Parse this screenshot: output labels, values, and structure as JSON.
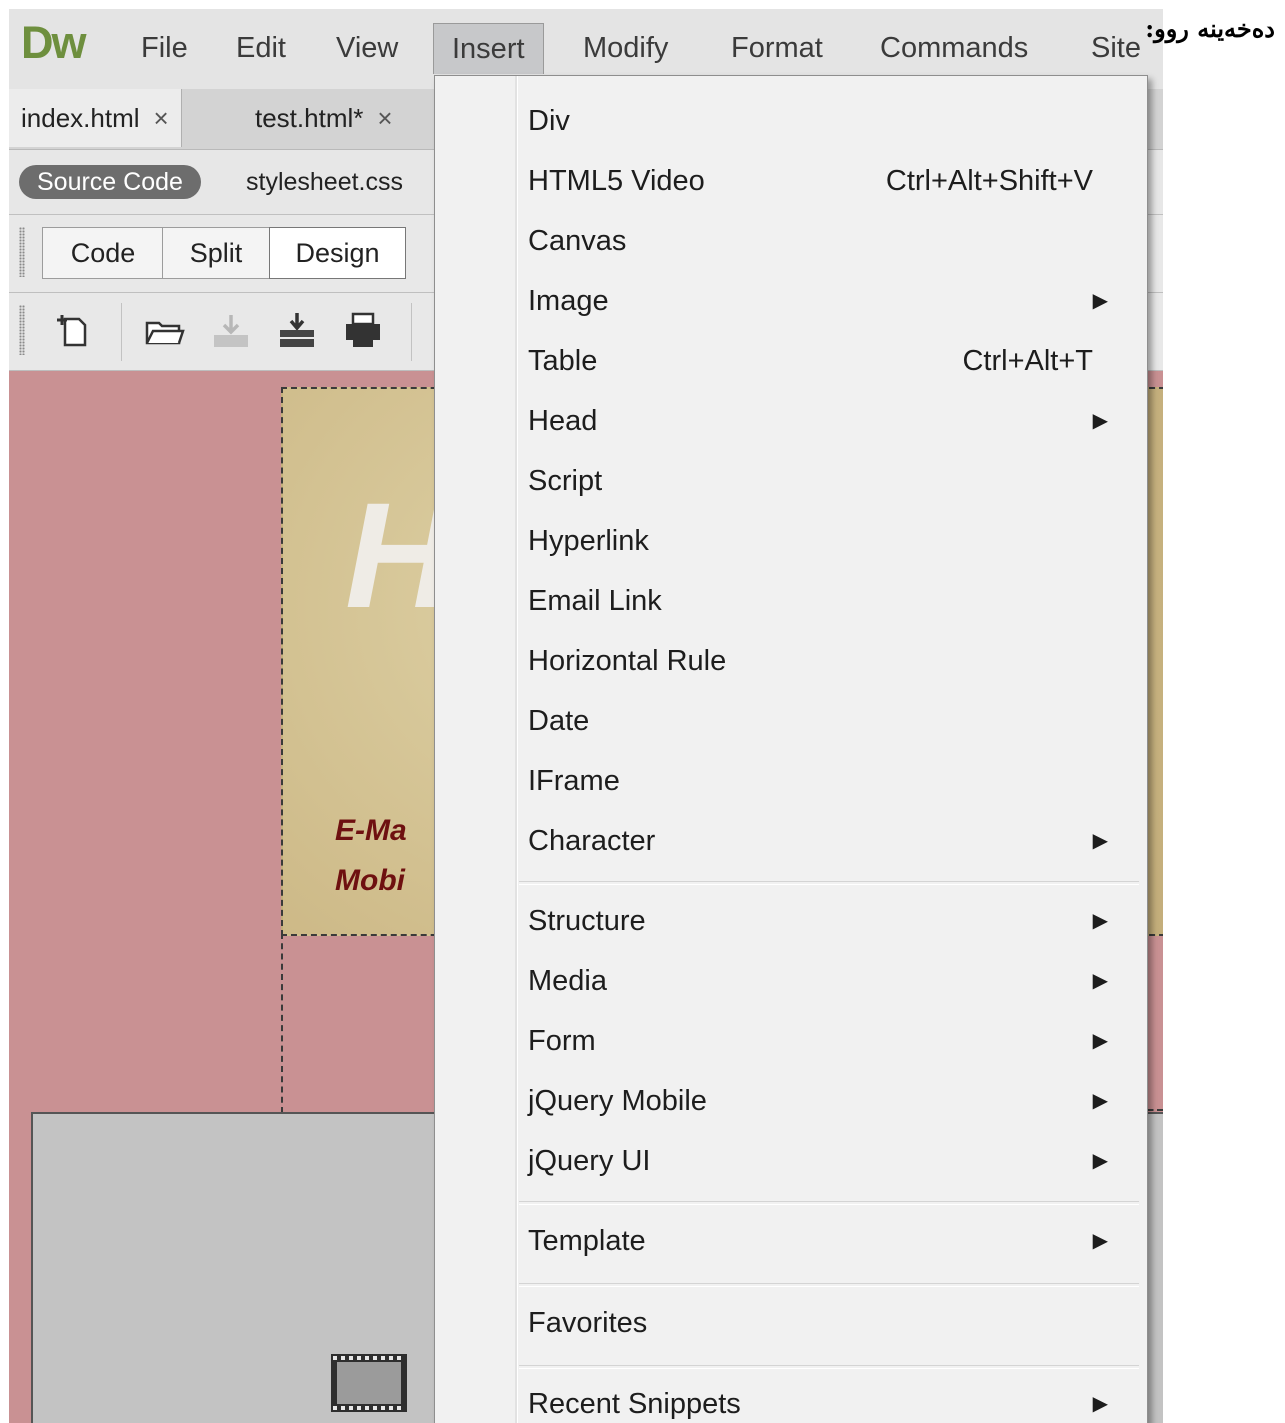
{
  "app": {
    "logo": "Dw"
  },
  "menubar": {
    "items": [
      "File",
      "Edit",
      "View",
      "Insert",
      "Modify",
      "Format",
      "Commands",
      "Site"
    ],
    "active": "Insert"
  },
  "tabs": [
    {
      "label": "index.html",
      "close": "×"
    },
    {
      "label": "test.html*",
      "close": "×"
    }
  ],
  "related_files": {
    "source_code": "Source Code",
    "file": "stylesheet.css"
  },
  "view_buttons": [
    "Code",
    "Split",
    "Design"
  ],
  "toolbar_icons": [
    "new-document-icon",
    "open-folder-icon",
    "save-down-icon",
    "save-all-icon",
    "print-icon"
  ],
  "canvas": {
    "header_initial": "H",
    "email_fragment": "E-Ma",
    "mobile_fragment": "Mobi"
  },
  "dropdown": {
    "items": [
      {
        "label": "Div",
        "shortcut": "",
        "submenu": false
      },
      {
        "label": "HTML5 Video",
        "shortcut": "Ctrl+Alt+Shift+V",
        "submenu": false
      },
      {
        "label": "Canvas",
        "shortcut": "",
        "submenu": false
      },
      {
        "label": "Image",
        "shortcut": "",
        "submenu": true
      },
      {
        "label": "Table",
        "shortcut": "Ctrl+Alt+T",
        "submenu": false
      },
      {
        "label": "Head",
        "shortcut": "",
        "submenu": true
      },
      {
        "label": "Script",
        "shortcut": "",
        "submenu": false
      },
      {
        "label": "Hyperlink",
        "shortcut": "",
        "submenu": false
      },
      {
        "label": "Email Link",
        "shortcut": "",
        "submenu": false
      },
      {
        "label": "Horizontal Rule",
        "shortcut": "",
        "submenu": false
      },
      {
        "label": "Date",
        "shortcut": "",
        "submenu": false
      },
      {
        "label": "IFrame",
        "shortcut": "",
        "submenu": false
      },
      {
        "label": "Character",
        "shortcut": "",
        "submenu": true
      },
      {
        "label": "Structure",
        "shortcut": "",
        "submenu": true
      },
      {
        "label": "Media",
        "shortcut": "",
        "submenu": true
      },
      {
        "label": "Form",
        "shortcut": "",
        "submenu": true
      },
      {
        "label": "jQuery Mobile",
        "shortcut": "",
        "submenu": true
      },
      {
        "label": "jQuery UI",
        "shortcut": "",
        "submenu": true
      },
      {
        "label": "Template",
        "shortcut": "",
        "submenu": true
      },
      {
        "label": "Favorites",
        "shortcut": "",
        "submenu": false
      },
      {
        "label": "Recent Snippets",
        "shortcut": "",
        "submenu": true
      }
    ],
    "submenu_arrow": "▶"
  },
  "caption": "دەخەینە روو:",
  "colors": {
    "page_bg": "#c99193",
    "menu_bg": "#f1f1f1",
    "logo": "#6e8f3e",
    "canvas_text": "#6e1010"
  }
}
